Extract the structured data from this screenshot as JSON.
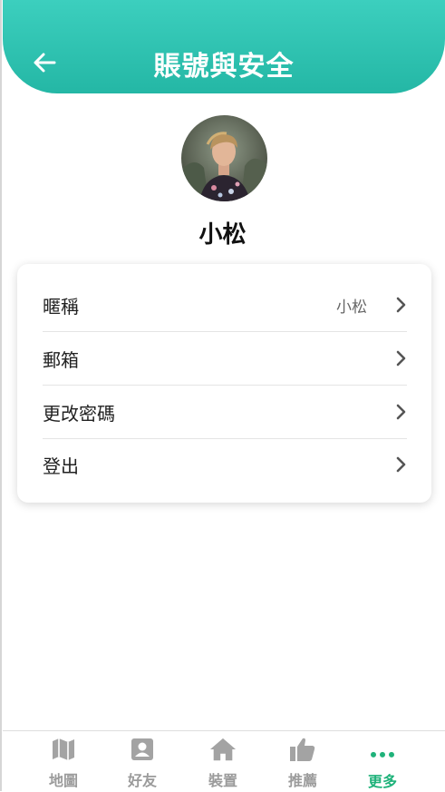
{
  "header": {
    "title": "賬號與安全",
    "back_icon": "arrow-left-icon",
    "gradient": [
      "#3ccfbe",
      "#24b7a5"
    ]
  },
  "profile": {
    "name": "小松",
    "avatar_icon": "user-photo"
  },
  "settings": {
    "items": [
      {
        "label": "暱稱",
        "value": "小松",
        "icon": "chevron-right-icon"
      },
      {
        "label": "郵箱",
        "value": "",
        "icon": "chevron-right-icon"
      },
      {
        "label": "更改密碼",
        "value": "",
        "icon": "chevron-right-icon"
      },
      {
        "label": "登出",
        "value": "",
        "icon": "chevron-right-icon"
      }
    ]
  },
  "tabbar": {
    "active_color": "#1fb27a",
    "inactive_color": "#9b9b9b",
    "tabs": [
      {
        "label": "地圖",
        "icon": "map-icon",
        "active": false
      },
      {
        "label": "好友",
        "icon": "contact-icon",
        "active": false
      },
      {
        "label": "裝置",
        "icon": "home-icon",
        "active": false
      },
      {
        "label": "推薦",
        "icon": "thumbs-up-icon",
        "active": false
      },
      {
        "label": "更多",
        "icon": "more-dots-icon",
        "active": true
      }
    ]
  }
}
